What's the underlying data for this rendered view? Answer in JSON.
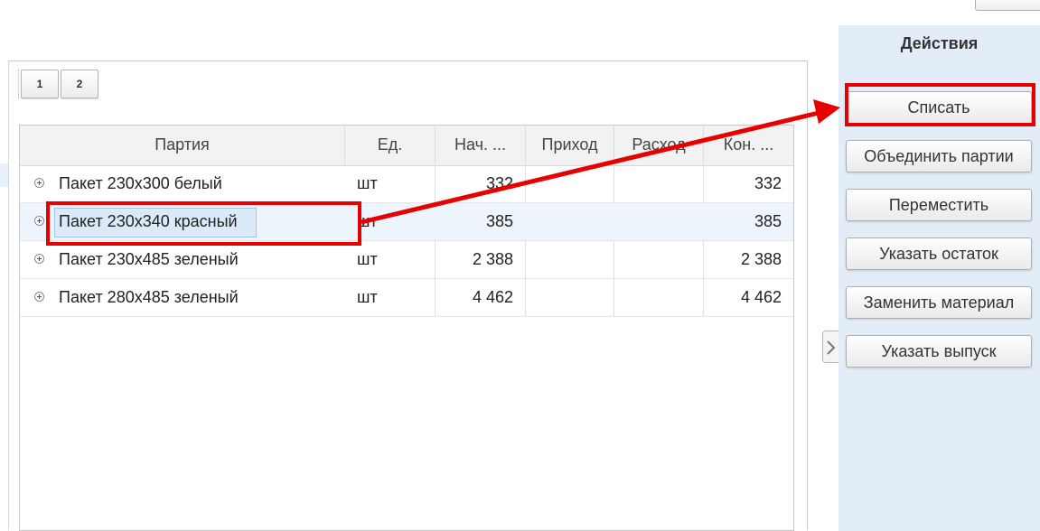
{
  "pager": {
    "pages": [
      "1",
      "2"
    ]
  },
  "table": {
    "columns": [
      "Партия",
      "Ед.",
      "Нач. ...",
      "Приход",
      "Расход",
      "Кон. ..."
    ],
    "rows": [
      {
        "name": "Пакет 230х300 белый",
        "unit": "шт",
        "start": "332",
        "income": "",
        "expense": "",
        "end": "332"
      },
      {
        "name": "Пакет 230х340 красный",
        "unit": "шт",
        "start": "385",
        "income": "",
        "expense": "",
        "end": "385"
      },
      {
        "name": "Пакет 230х485 зеленый",
        "unit": "шт",
        "start": "2 388",
        "income": "",
        "expense": "",
        "end": "2 388"
      },
      {
        "name": "Пакет 280х485 зеленый",
        "unit": "шт",
        "start": "4 462",
        "income": "",
        "expense": "",
        "end": "4 462"
      }
    ]
  },
  "actions": {
    "title": "Действия",
    "buttons": [
      "Списать",
      "Объединить партии",
      "Переместить",
      "Указать остаток",
      "Заменить материал",
      "Указать выпуск"
    ]
  },
  "colors": {
    "annotation_red": "#e60000",
    "actions_panel_bg": "#e3edf8",
    "selected_row_bg": "#eef4fb"
  }
}
